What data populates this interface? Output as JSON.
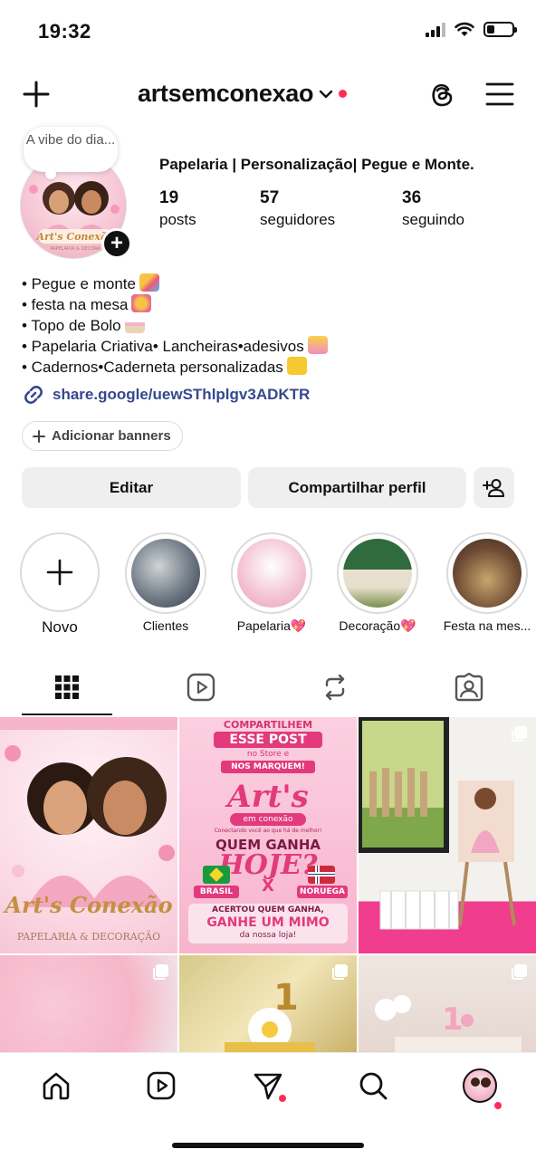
{
  "status_bar": {
    "time": "19:32"
  },
  "header": {
    "username": "artsemconexao"
  },
  "profile": {
    "note": "A vibe do dia...",
    "display_name": "Papelaria | Personalização| Pegue e Monte.",
    "posts_count": "19",
    "posts_label": "posts",
    "followers_count": "57",
    "followers_label": "seguidores",
    "following_count": "36",
    "following_label": "seguindo",
    "bio": [
      "• Pegue e monte",
      "• festa na mesa",
      "• Topo de Bolo",
      "• Papelaria Criativa• Lancheiras•adesivos",
      "• Cadernos•Caderneta personalizadas"
    ],
    "link": "share.google/uewSThlplgv3ADKTR",
    "banner_button": "Adicionar banners"
  },
  "actions": {
    "edit": "Editar",
    "share": "Compartilhar perfil"
  },
  "highlights": [
    {
      "label": "Novo"
    },
    {
      "label": "Clientes"
    },
    {
      "label": "Papelaria💖"
    },
    {
      "label": "Decoração💖"
    },
    {
      "label": "Festa na mes..."
    }
  ],
  "tabs": [
    "grid-icon",
    "reels-icon",
    "reposts-icon",
    "tagged-icon"
  ],
  "posts": {
    "p1": {
      "title": "Art's Conexão",
      "subtitle": "PAPELARIA & DECORAÇÃO"
    },
    "p2": {
      "l1": "COMPARTILHEM",
      "l2": "ESSE POST",
      "l3": "no Store e",
      "l4": "NOS MARQUEM!",
      "brand1": "Art's",
      "brand2": "em conexão",
      "tagline": "Conectando você ao que há de melhor!",
      "q1": "QUEM GANHA",
      "q2": "HOJE?",
      "team1": "BRASIL",
      "vs": "X",
      "team2": "NORUEGA",
      "p1": "ACERTOU QUEM GANHA,",
      "p2": "GANHE UM MIMO",
      "p3": "da nossa loja!"
    }
  },
  "colors": {
    "link": "#35488f",
    "notification": "#ff2d55",
    "pink": "#f7a1c4"
  }
}
